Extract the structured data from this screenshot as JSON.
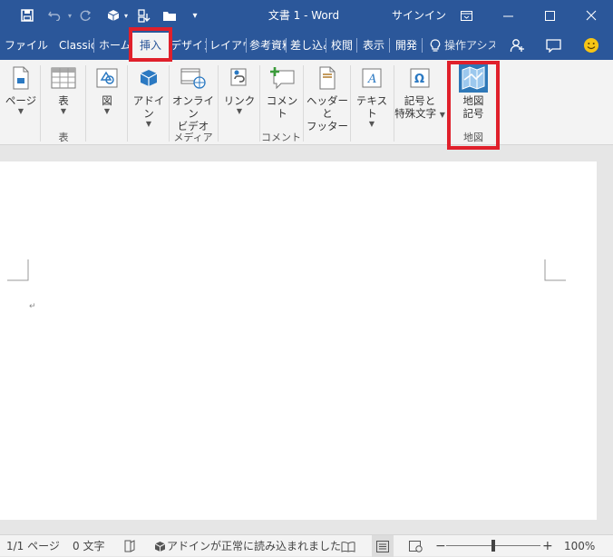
{
  "title_bar": {
    "title": "文書 1 - Word",
    "signin": "サインイン",
    "icons": [
      "save-icon",
      "undo-icon",
      "redo-icon",
      "addin-icon",
      "touch-mode-icon",
      "open-folder-icon",
      "customize-qat-icon",
      "ribbon-display-options-icon",
      "minimize-icon",
      "maximize-icon",
      "close-icon"
    ]
  },
  "tabs": [
    {
      "label": "ファイル"
    },
    {
      "label": "Classic"
    },
    {
      "label": "ホーム"
    },
    {
      "label": "挿入",
      "active": true
    },
    {
      "label": "デザイン"
    },
    {
      "label": "レイアウト"
    },
    {
      "label": "参考資料"
    },
    {
      "label": "差し込み文書"
    },
    {
      "label": "校閲"
    },
    {
      "label": "表示"
    },
    {
      "label": "開発"
    }
  ],
  "tell_me": {
    "label": "操作アシスト"
  },
  "ribbon": {
    "page": {
      "label": "ページ"
    },
    "table": {
      "label": "表",
      "group": "表"
    },
    "illustration": {
      "label": "図"
    },
    "addins": {
      "label": "アドイン"
    },
    "online_video": {
      "label1": "オンライン",
      "label2": "ビデオ",
      "group": "メディア"
    },
    "link": {
      "label": "リンク"
    },
    "comment": {
      "label": "コメント",
      "group": "コメント"
    },
    "header_footer": {
      "label1": "ヘッダーと",
      "label2": "フッター"
    },
    "text": {
      "label": "テキスト"
    },
    "symbols": {
      "label1": "記号と",
      "label2": "特殊文字"
    },
    "map_symbol": {
      "label1": "地図",
      "label2": "記号",
      "group": "地図"
    }
  },
  "status_bar": {
    "page": "1/1 ページ",
    "words": "0 文字",
    "addin_status": "アドインが正常に読み込まれました",
    "zoom": "100%",
    "zoom_minus": "−",
    "zoom_plus": "+",
    "zoom_level": 1.0
  },
  "colors": {
    "accent": "#2b579a",
    "highlight": "#e0202b"
  }
}
